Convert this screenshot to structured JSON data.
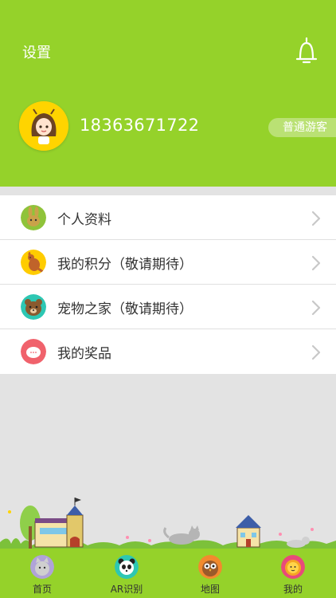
{
  "header": {
    "settings_label": "设置",
    "bell_icon": "bell-icon",
    "phone": "18363671722",
    "user_type": "普通游客",
    "background": "#95d22a"
  },
  "menu": {
    "items": [
      {
        "label": "个人资料",
        "icon": "rabbit-icon"
      },
      {
        "label": "我的积分（敬请期待）",
        "icon": "kangaroo-icon"
      },
      {
        "label": "宠物之家（敬请期待）",
        "icon": "bear-icon"
      },
      {
        "label": "我的奖品",
        "icon": "gift-icon"
      }
    ]
  },
  "tabs": [
    {
      "label": "首页",
      "icon": "cat-icon"
    },
    {
      "label": "AR识别",
      "icon": "panda-icon"
    },
    {
      "label": "地图",
      "icon": "owl-icon"
    },
    {
      "label": "我的",
      "icon": "lion-icon"
    }
  ]
}
